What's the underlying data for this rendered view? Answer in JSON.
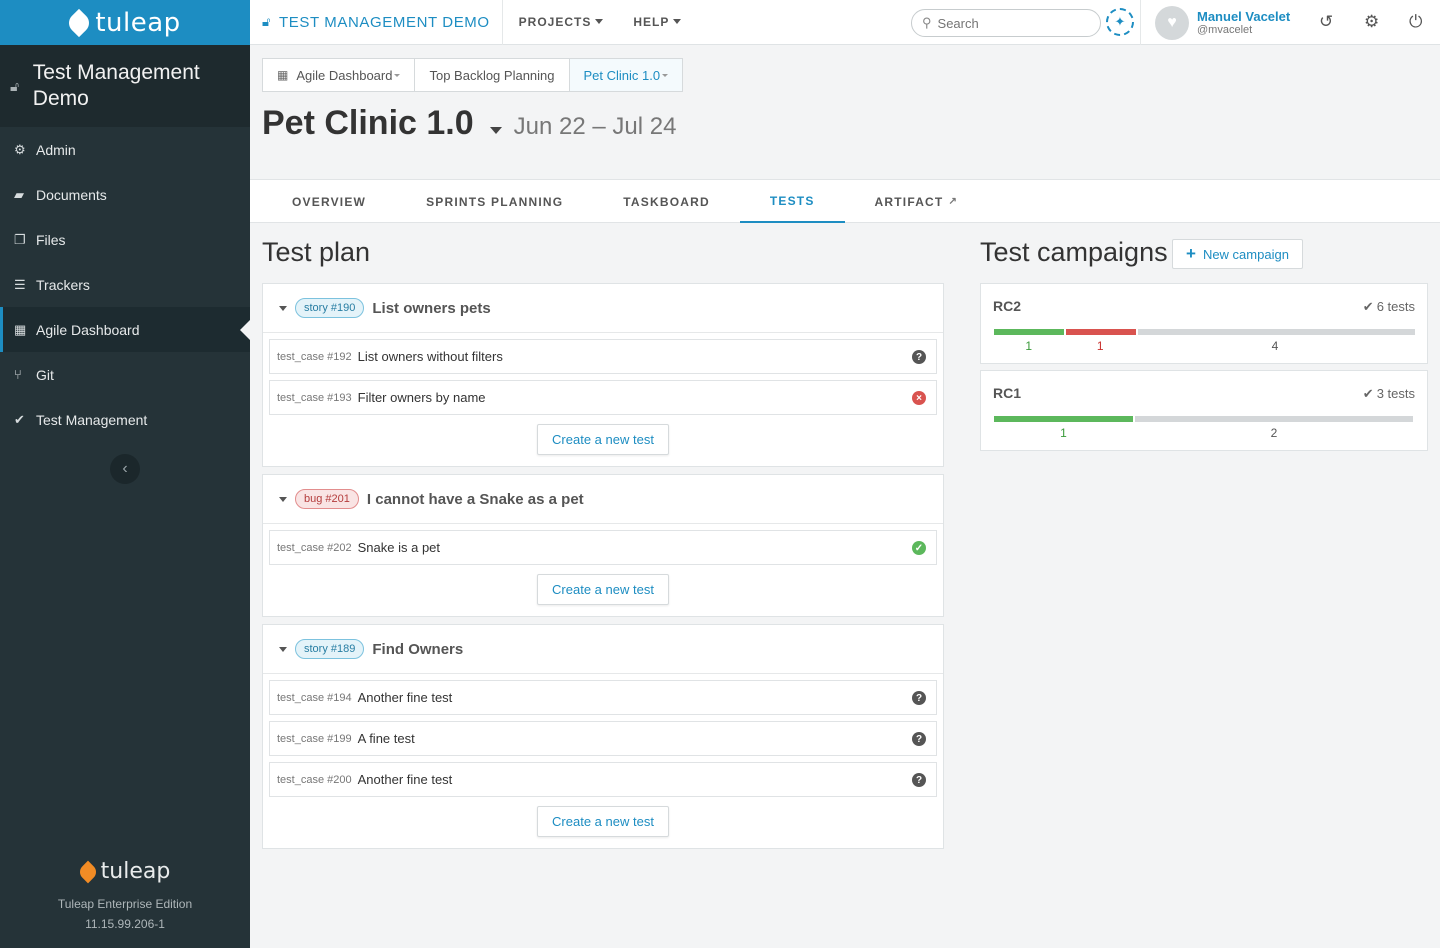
{
  "sidebar": {
    "logo_text": "tuleap",
    "project_name": "Test Management Demo",
    "items": [
      {
        "label": "Admin",
        "icon": "gears-icon"
      },
      {
        "label": "Documents",
        "icon": "folder-icon"
      },
      {
        "label": "Files",
        "icon": "files-icon"
      },
      {
        "label": "Trackers",
        "icon": "list-icon"
      },
      {
        "label": "Agile Dashboard",
        "icon": "table-icon",
        "active": true
      },
      {
        "label": "Git",
        "icon": "git-icon"
      },
      {
        "label": "Test Management",
        "icon": "check-icon"
      }
    ],
    "footer_logo": "tuleap",
    "edition": "Tuleap Enterprise Edition",
    "version": "11.15.99.206-1"
  },
  "topbar": {
    "project": "TEST MANAGEMENT DEMO",
    "menus": [
      "PROJECTS",
      "HELP"
    ],
    "search_placeholder": "Search",
    "user_name": "Manuel Vacelet",
    "user_login": "@mvacelet"
  },
  "breadcrumb": [
    "Agile Dashboard",
    "Top Backlog Planning",
    "Pet Clinic 1.0"
  ],
  "milestone": {
    "title": "Pet Clinic 1.0",
    "dates": "Jun 22 – Jul 24"
  },
  "tabs": [
    "OVERVIEW",
    "SPRINTS PLANNING",
    "TASKBOARD",
    "TESTS",
    "ARTIFACT"
  ],
  "test_plan": {
    "title": "Test plan",
    "create_label": "Create a new test",
    "blocks": [
      {
        "badge": "story #190",
        "badge_type": "story",
        "label": "List owners pets",
        "tests": [
          {
            "ref": "test_case #192",
            "label": "List owners without filters",
            "status": "notrun"
          },
          {
            "ref": "test_case #193",
            "label": "Filter owners by name",
            "status": "failed"
          }
        ]
      },
      {
        "badge": "bug #201",
        "badge_type": "bug",
        "label": "I cannot have a Snake as a pet",
        "tests": [
          {
            "ref": "test_case #202",
            "label": "Snake is a pet",
            "status": "passed"
          }
        ]
      },
      {
        "badge": "story #189",
        "badge_type": "story",
        "label": "Find Owners",
        "tests": [
          {
            "ref": "test_case #194",
            "label": "Another fine test",
            "status": "notrun"
          },
          {
            "ref": "test_case #199",
            "label": "A fine test",
            "status": "notrun"
          },
          {
            "ref": "test_case #200",
            "label": "Another fine test",
            "status": "notrun"
          }
        ]
      }
    ]
  },
  "campaigns": {
    "title": "Test campaigns",
    "new_label": "New campaign",
    "items": [
      {
        "name": "RC2",
        "count": "6 tests",
        "passed": 1,
        "failed": 1,
        "notrun": 4
      },
      {
        "name": "RC1",
        "count": "3 tests",
        "passed": 1,
        "failed": 0,
        "notrun": 2
      }
    ]
  },
  "colors": {
    "accent": "#1d8dc2",
    "passed": "#5cb85c",
    "failed": "#d9534f",
    "notrun": "#d4d7d9"
  }
}
